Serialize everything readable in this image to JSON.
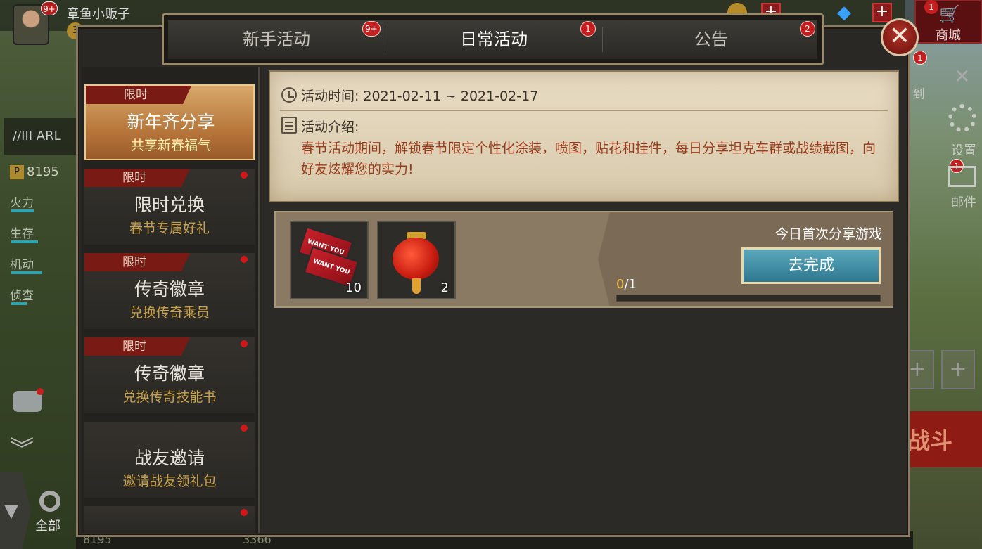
{
  "player": {
    "name": "章鱼小贩子",
    "avatar_badge": "9+",
    "level": "3"
  },
  "shop": {
    "label": "商城",
    "badge": "1"
  },
  "side": {
    "sign_label": "到",
    "sign_badge": "1",
    "settings_label": "设置",
    "mail_label": "邮件",
    "mail_badge": "1"
  },
  "tank": {
    "tag": "ARL",
    "power": "8195",
    "stats": [
      "火力",
      "生存",
      "机动",
      "侦查"
    ]
  },
  "bottom": {
    "all_label": "全部",
    "val1": "8195",
    "val2": "3366",
    "battle_label": "战斗"
  },
  "tabs": [
    {
      "label": "新手活动",
      "badge": "9+",
      "active": false
    },
    {
      "label": "日常活动",
      "badge": "1",
      "active": true
    },
    {
      "label": "公告",
      "badge": "2",
      "active": false
    }
  ],
  "close_label": "✕",
  "menu": [
    {
      "tag": "限时",
      "title": "新年齐分享",
      "sub": "共享新春福气",
      "active": true,
      "dot": false
    },
    {
      "tag": "限时",
      "title": "限时兑换",
      "sub": "春节专属好礼",
      "active": false,
      "dot": true
    },
    {
      "tag": "限时",
      "title": "传奇徽章",
      "sub": "兑换传奇乘员",
      "active": false,
      "dot": true
    },
    {
      "tag": "限时",
      "title": "传奇徽章",
      "sub": "兑换传奇技能书",
      "active": false,
      "dot": true
    },
    {
      "tag": "",
      "title": "战友邀请",
      "sub": "邀请战友领礼包",
      "active": false,
      "dot": true
    },
    {
      "tag": "",
      "title": "",
      "sub": "",
      "active": false,
      "dot": true
    }
  ],
  "info": {
    "time_label": "活动时间: 2021-02-11 ~ 2021-02-17",
    "intro_label": "活动介绍:",
    "intro_text": "春节活动期间，解锁春节限定个性化涂装，喷图，贴花和挂件，每日分享坦克车群或战绩截图，向好友炫耀您的实力!"
  },
  "task": {
    "title": "今日首次分享游戏",
    "button": "去完成",
    "progress_current": "0",
    "progress_total": "/1",
    "progress_fraction": 0,
    "rewards": [
      {
        "icon": "ticket-icon",
        "count": "10",
        "ticket_text": "WANT YOU"
      },
      {
        "icon": "lantern-icon",
        "count": "2"
      }
    ]
  },
  "colors": {
    "accent_red": "#c41e1e",
    "go_button": "#3a8aa2",
    "progress": "#f0c040",
    "sub_gold": "#c8a24a"
  }
}
